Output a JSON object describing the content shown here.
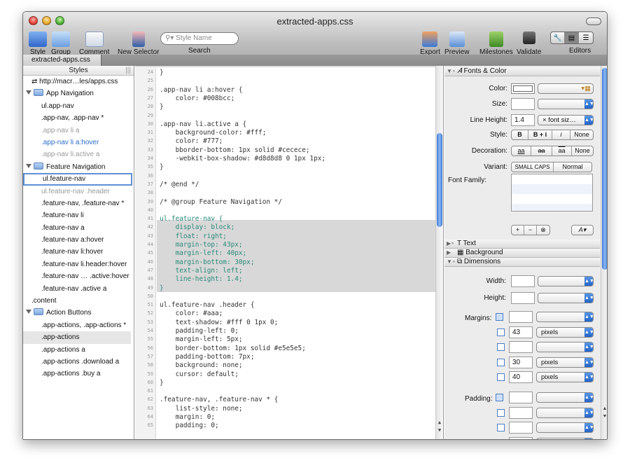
{
  "window": {
    "title": "extracted-apps.css"
  },
  "toolbar": {
    "style": "Style",
    "group": "Group",
    "comment": "Comment",
    "new_selector": "New Selector",
    "search_placeholder": "Style Name",
    "search_label": "Search",
    "export": "Export",
    "preview": "Preview",
    "milestones": "Milestones",
    "validate": "Validate",
    "editors": "Editors"
  },
  "tab": {
    "label": "extracted-apps.css"
  },
  "sidebar": {
    "header": "Styles",
    "items": [
      {
        "text": "http://macr…les/apps.css",
        "kind": "link"
      },
      {
        "text": "App Navigation",
        "kind": "folder"
      },
      {
        "text": "ul.app-nav",
        "kind": "rule"
      },
      {
        "text": ".app-nav, .app-nav *",
        "kind": "rule"
      },
      {
        "text": ".app-nav li a",
        "kind": "grey"
      },
      {
        "text": ".app-nav li a:hover",
        "kind": "blue"
      },
      {
        "text": ".app-nav li.active a",
        "kind": "grey"
      },
      {
        "text": "Feature Navigation",
        "kind": "folder"
      },
      {
        "text": "ul.feature-nav",
        "kind": "selected"
      },
      {
        "text": "ul.feature-nav .header",
        "kind": "grey"
      },
      {
        "text": ".feature-nav, .feature-nav *",
        "kind": "rule"
      },
      {
        "text": ".feature-nav li",
        "kind": "rule"
      },
      {
        "text": ".feature-nav a",
        "kind": "rule"
      },
      {
        "text": ".feature-nav a:hover",
        "kind": "rule"
      },
      {
        "text": ".feature-nav li:hover",
        "kind": "rule"
      },
      {
        "text": ".feature-nav li.header:hover",
        "kind": "rule"
      },
      {
        "text": ".feature-nav … .active:hover",
        "kind": "rule"
      },
      {
        "text": ".feature-nav .active a",
        "kind": "rule"
      },
      {
        "text": ".content",
        "kind": "rule0"
      },
      {
        "text": "Action Buttons",
        "kind": "folder"
      },
      {
        "text": ".app-actions, .app-actions *",
        "kind": "rule"
      },
      {
        "text": ".app-actions",
        "kind": "hl"
      },
      {
        "text": ".app-actions a",
        "kind": "rule"
      },
      {
        "text": ".app-actions .download a",
        "kind": "rule"
      },
      {
        "text": ".app-actions .buy a",
        "kind": "rule"
      }
    ]
  },
  "editor": {
    "lines": [
      {
        "n": "24",
        "t": "}"
      },
      {
        "n": "25",
        "t": ""
      },
      {
        "n": "26",
        "t": ".app-nav li a:hover {"
      },
      {
        "n": "27",
        "t": "    color: #008bcc;"
      },
      {
        "n": "28",
        "t": "}"
      },
      {
        "n": "29",
        "t": ""
      },
      {
        "n": "30",
        "t": ".app-nav li.active a {"
      },
      {
        "n": "31",
        "t": "    background-color: #fff;"
      },
      {
        "n": "32",
        "t": "    color: #777;"
      },
      {
        "n": "33",
        "t": "    bborder-bottom: 1px solid #cecece;"
      },
      {
        "n": "34",
        "t": "    -webkit-box-shadow: #d8d8d8 0 1px 1px;"
      },
      {
        "n": "35",
        "t": "}"
      },
      {
        "n": "36",
        "t": ""
      },
      {
        "n": "37",
        "t": "/* @end */"
      },
      {
        "n": "38",
        "t": ""
      },
      {
        "n": "39",
        "t": "/* @group Feature Navigation */"
      },
      {
        "n": "40",
        "t": ""
      },
      {
        "n": "41",
        "t": "ul.feature-nav {",
        "hl": true
      },
      {
        "n": "42",
        "t": "    display: block;",
        "hl": true
      },
      {
        "n": "43",
        "t": "    float: right;",
        "hl": true
      },
      {
        "n": "44",
        "t": "    margin-top: 43px;",
        "hl": true
      },
      {
        "n": "45",
        "t": "    margin-left: 40px;",
        "hl": true
      },
      {
        "n": "46",
        "t": "    margin-bottom: 30px;",
        "hl": true
      },
      {
        "n": "47",
        "t": "    text-align: left;",
        "hl": true
      },
      {
        "n": "48",
        "t": "    line-height: 1.4;",
        "hl": true
      },
      {
        "n": "49",
        "t": "}",
        "hl": true
      },
      {
        "n": "50",
        "t": ""
      },
      {
        "n": "51",
        "t": "ul.feature-nav .header {"
      },
      {
        "n": "52",
        "t": "    color: #aaa;"
      },
      {
        "n": "53",
        "t": "    text-shadow: #fff 0 1px 0;"
      },
      {
        "n": "54",
        "t": "    padding-left: 0;"
      },
      {
        "n": "55",
        "t": "    margin-left: 5px;"
      },
      {
        "n": "56",
        "t": "    border-bottom: 1px solid #e5e5e5;"
      },
      {
        "n": "57",
        "t": "    padding-bottom: 7px;"
      },
      {
        "n": "58",
        "t": "    background: none;"
      },
      {
        "n": "59",
        "t": "    cursor: default;"
      },
      {
        "n": "60",
        "t": "}"
      },
      {
        "n": "61",
        "t": ""
      },
      {
        "n": "62",
        "t": ".feature-nav, .feature-nav * {"
      },
      {
        "n": "63",
        "t": "    list-style: none;"
      },
      {
        "n": "64",
        "t": "    margin: 0;"
      },
      {
        "n": "65",
        "t": "    padding: 0;"
      }
    ]
  },
  "inspector": {
    "fonts_color": "Fonts & Color",
    "color_label": "Color:",
    "size_label": "Size:",
    "line_height_label": "Line Height:",
    "line_height_value": "1.4",
    "line_height_unit": "× font siz…",
    "style_label": "Style:",
    "style_opts": [
      "B",
      "B + i",
      "i",
      "None"
    ],
    "decoration_label": "Decoration:",
    "decoration_opts": [
      "aa",
      "aa",
      "aa",
      "None"
    ],
    "variant_label": "Variant:",
    "variant_opts": [
      "SMALL CAPS",
      "Normal"
    ],
    "font_family_label": "Font Family:",
    "text": "Text",
    "background": "Background",
    "dimensions": "Dimensions",
    "width_label": "Width:",
    "height_label": "Height:",
    "margins_label": "Margins:",
    "margin_values": [
      "",
      "43",
      "",
      "30",
      "40"
    ],
    "margin_units": [
      "",
      "pixels",
      "",
      "pixels",
      "pixels"
    ],
    "padding_label": "Padding:"
  }
}
